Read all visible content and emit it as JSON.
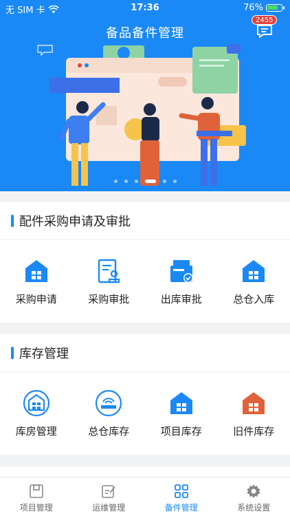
{
  "status_bar": {
    "carrier": "无 SIM 卡",
    "time": "17:36",
    "battery": "76%"
  },
  "header": {
    "title": "备品备件管理",
    "badge_count": "2455"
  },
  "carousel": {
    "slide_count": 5,
    "active_index": 3
  },
  "sections": [
    {
      "title": "配件采购申请及审批",
      "items": [
        {
          "label": "采购申请",
          "icon": "warehouse-icon"
        },
        {
          "label": "采购审批",
          "icon": "approval-document-icon"
        },
        {
          "label": "出库审批",
          "icon": "outbound-approval-icon"
        },
        {
          "label": "总仓入库",
          "icon": "warehouse-icon"
        }
      ]
    },
    {
      "title": "库存管理",
      "items": [
        {
          "label": "库房管理",
          "icon": "storehouse-circle-icon"
        },
        {
          "label": "总仓库存",
          "icon": "warehouse-stock-circle-icon"
        },
        {
          "label": "项目库存",
          "icon": "warehouse-icon"
        },
        {
          "label": "旧件库存",
          "icon": "old-parts-warehouse-icon"
        }
      ]
    }
  ],
  "tabbar": {
    "tabs": [
      {
        "label": "项目管理",
        "icon": "project-icon"
      },
      {
        "label": "运维管理",
        "icon": "maintenance-icon"
      },
      {
        "label": "备件管理",
        "icon": "spare-parts-icon"
      },
      {
        "label": "系统设置",
        "icon": "settings-gear-icon"
      }
    ],
    "active_tab": "备件管理"
  },
  "colors": {
    "primary": "#1a89f5",
    "badge": "#e8413c",
    "old_parts": "#e0623a"
  }
}
